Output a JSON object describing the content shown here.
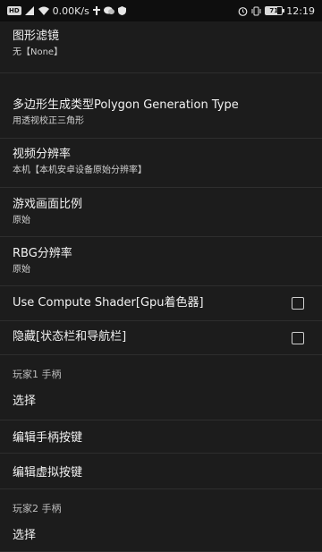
{
  "status_bar": {
    "badge": "HD",
    "speed": "0.00K/s",
    "battery": "71",
    "time": "12:19"
  },
  "settings": {
    "graphics_filter": {
      "title": "图形滤镜",
      "value": "无【None】"
    },
    "polygon_type": {
      "title": "多边形生成类型Polygon Generation Type",
      "value": "用透视校正三角形"
    },
    "video_resolution": {
      "title": "视频分辨率",
      "value": "本机【本机安卓设备原始分辨率】"
    },
    "aspect_ratio": {
      "title": "游戏画面比例",
      "value": "原始"
    },
    "rbg_resolution": {
      "title": "RBG分辨率",
      "value": "原始"
    },
    "compute_shader": {
      "title": "Use Compute Shader[Gpu着色器]",
      "checked": false
    },
    "hide_bars": {
      "title": "隐藏[状态栏和导航栏]",
      "checked": false
    },
    "player1_header": "玩家1 手柄",
    "player1_select": "选择",
    "edit_gamepad": "编辑手柄按键",
    "edit_virtual": "编辑虚拟按键",
    "player2_header": "玩家2 手柄",
    "player2_select": "选择"
  }
}
